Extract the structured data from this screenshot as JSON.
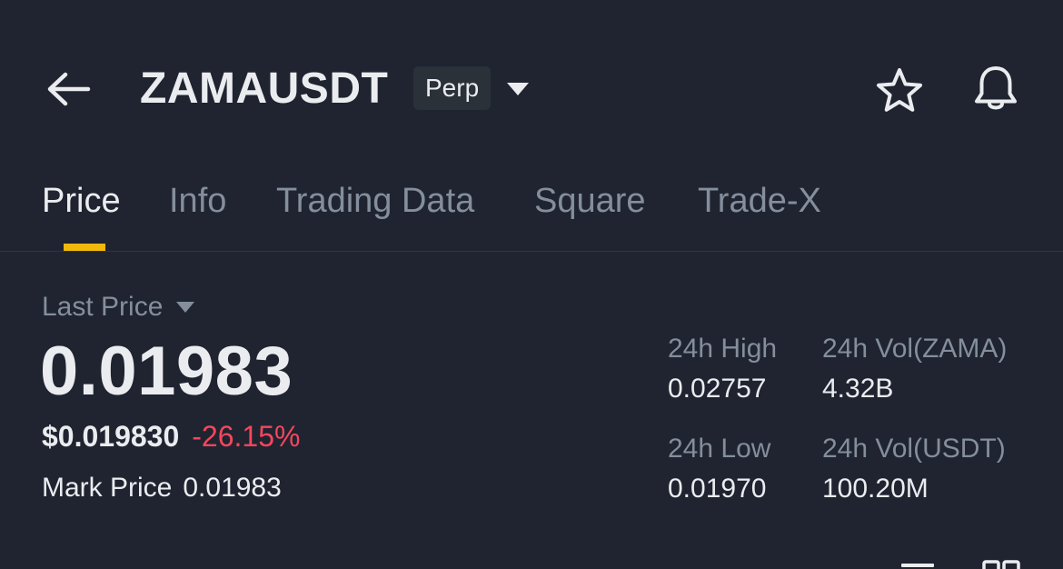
{
  "header": {
    "back_icon": "arrow-left-icon",
    "symbol": "ZAMAUSDT",
    "contract_badge": "Perp",
    "symbol_dropdown_icon": "caret-down-icon",
    "favorite_icon": "star-icon",
    "alert_icon": "bell-icon"
  },
  "tabs": [
    {
      "label": "Price",
      "active": true
    },
    {
      "label": "Info",
      "active": false
    },
    {
      "label": "Trading Data",
      "active": false
    },
    {
      "label": "Square",
      "active": false
    },
    {
      "label": "Trade-X",
      "active": false
    }
  ],
  "price_panel": {
    "last_price_label": "Last Price",
    "last_price": "0.01983",
    "usd_value": "$0.019830",
    "change_percent": "-26.15%",
    "mark_price_label": "Mark Price",
    "mark_price": "0.01983"
  },
  "stats": {
    "high_label": "24h High",
    "high_value": "0.02757",
    "vol_base_label": "24h Vol(ZAMA)",
    "vol_base_value": "4.32B",
    "low_label": "24h Low",
    "low_value": "0.01970",
    "vol_quote_label": "24h Vol(USDT)",
    "vol_quote_value": "100.20M"
  },
  "colors": {
    "background": "#1f2430",
    "accent": "#f0b90b",
    "negative": "#f6465d",
    "muted_text": "#848e9c",
    "primary_text": "#eaecef"
  }
}
